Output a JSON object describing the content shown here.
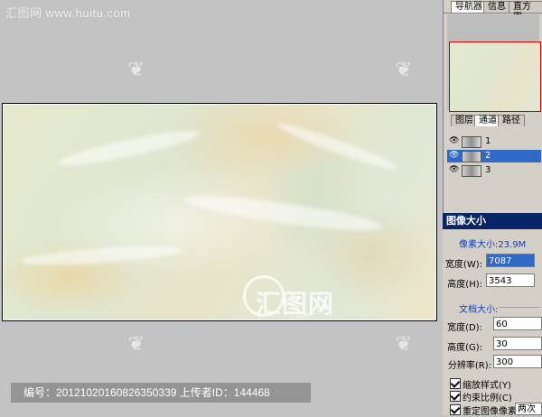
{
  "watermark": {
    "header": "汇图网 www.huitu.com",
    "center_logo": "汇图网",
    "center_url": "www.huitu.com",
    "footer": "编号：20121020160826350339 上传者ID：144468"
  },
  "navigator_tabs": [
    "导航器",
    "信息",
    "直方图"
  ],
  "layer_tabs": [
    "图层",
    "通道",
    "路径"
  ],
  "channels": [
    {
      "label": "1",
      "selected": false
    },
    {
      "label": "2",
      "selected": true
    },
    {
      "label": "3",
      "selected": false
    }
  ],
  "image_size": {
    "title": "图像大小",
    "pixel_size_label": "像素大小:23.9M",
    "width_label": "宽度(W):",
    "width_value": "7087",
    "height_label": "高度(H):",
    "height_value": "3543",
    "doc_size_label": "文档大小:",
    "doc_width_label": "宽度(D):",
    "doc_width_value": "60",
    "doc_height_label": "高度(G):",
    "doc_height_value": "30",
    "resolution_label": "分辨率(R):",
    "resolution_value": "300",
    "scale_styles": "缩放样式(Y)",
    "constrain": "约束比例(C)",
    "resample": "重定图像像素(I):",
    "resample_method": "两次"
  },
  "colors": {
    "accent_blue": "#316ac5",
    "title_bar": "#0a246a",
    "panel_bg": "#d4d0c8",
    "workspace": "#c3c3c3"
  }
}
